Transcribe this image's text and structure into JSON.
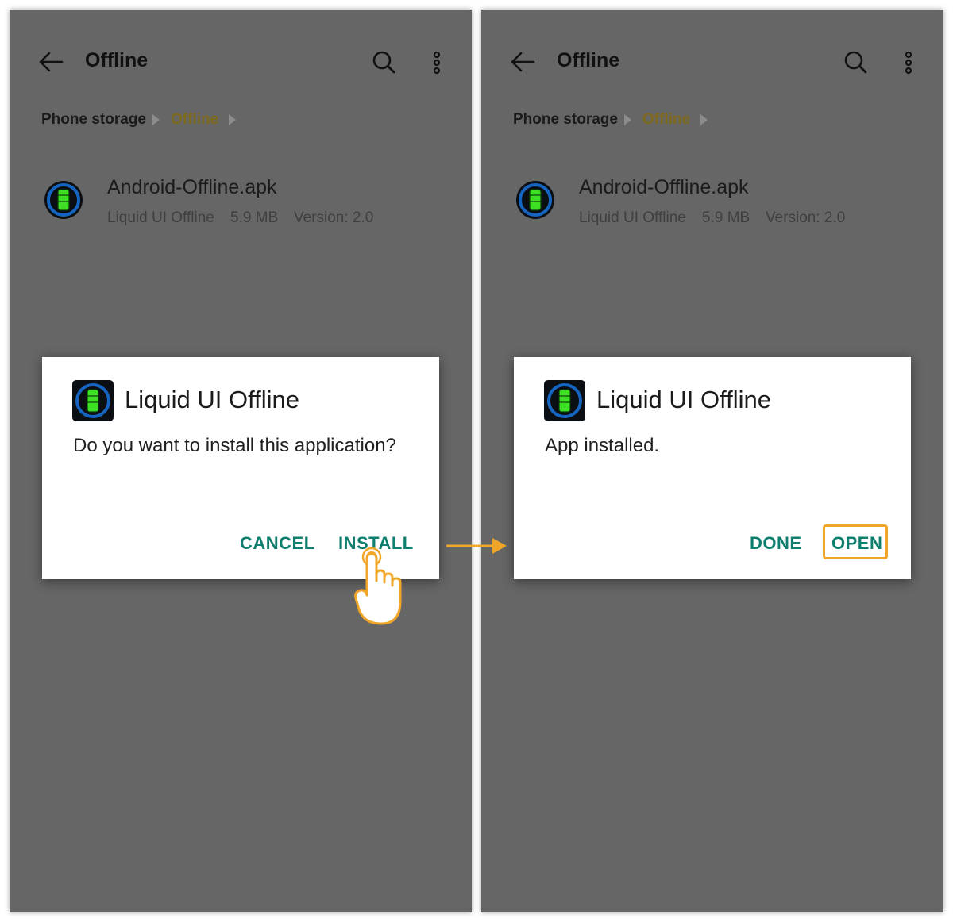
{
  "left_screen": {
    "appbar": {
      "title": "Offline",
      "back_icon": "arrow-left-icon",
      "search_icon": "search-icon",
      "more_icon": "more-vertical-icon"
    },
    "breadcrumb": {
      "root": "Phone storage",
      "current": "Offline"
    },
    "file": {
      "name": "Android-Offline.apk",
      "publisher": "Liquid UI Offline",
      "size": "5.9 MB",
      "version": "Version: 2.0"
    },
    "dialog": {
      "title": "Liquid UI Offline",
      "message": "Do you want to install this application?",
      "cancel_label": "CANCEL",
      "install_label": "INSTALL"
    }
  },
  "right_screen": {
    "appbar": {
      "title": "Offline",
      "back_icon": "arrow-left-icon",
      "search_icon": "search-icon",
      "more_icon": "more-vertical-icon"
    },
    "breadcrumb": {
      "root": "Phone storage",
      "current": "Offline"
    },
    "file": {
      "name": "Android-Offline.apk",
      "publisher": "Liquid UI Offline",
      "size": "5.9 MB",
      "version": "Version: 2.0"
    },
    "dialog": {
      "title": "Liquid UI Offline",
      "message": "App installed.",
      "done_label": "DONE",
      "open_label": "OPEN"
    }
  },
  "colors": {
    "screen_background": "#666666",
    "accent_teal": "#0e7e6e",
    "breadcrumb_current": "#7e6a1e",
    "highlight_orange": "#f0a629",
    "app_icon_green": "#3ee024",
    "app_icon_ring": "#1565c0"
  },
  "annotations": {
    "tap_gesture_icon": "tap-hand-icon",
    "step_arrow_icon": "arrow-right-icon"
  }
}
